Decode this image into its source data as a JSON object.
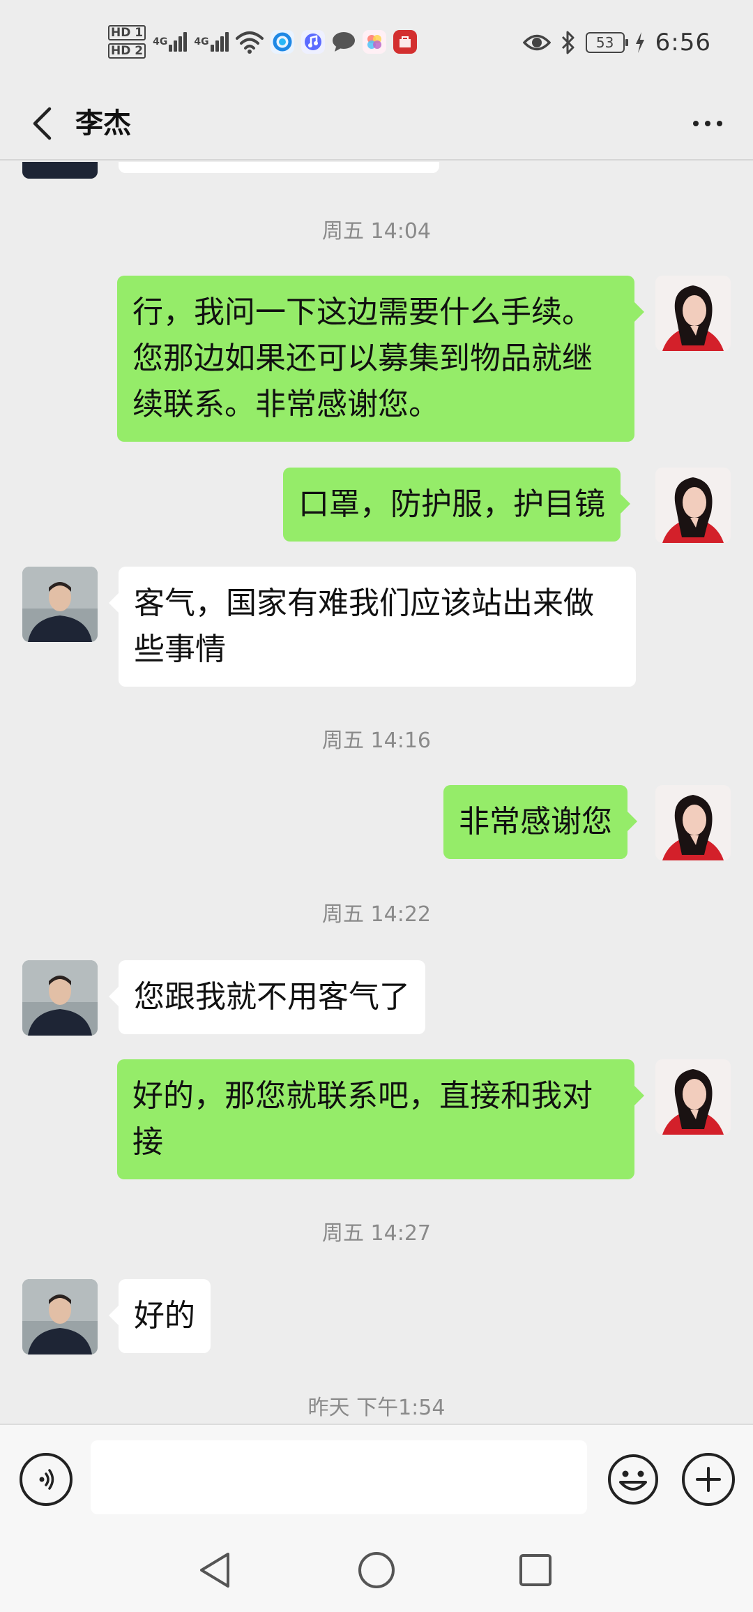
{
  "status_bar": {
    "hd_labels": [
      "HD 1",
      "HD 2"
    ],
    "network_labels": [
      "4G",
      "4G"
    ],
    "battery_level": "53",
    "time": "6:56",
    "icons": [
      "hd-icon",
      "signal-icon",
      "signal-icon",
      "wifi-icon",
      "browser-icon",
      "music-icon",
      "message-icon",
      "photos-icon",
      "huawei-icon",
      "eye-icon",
      "bluetooth-icon",
      "battery-icon",
      "charging-icon"
    ]
  },
  "title_bar": {
    "title": "李杰",
    "back_icon": "chevron-left-icon",
    "more_icon": "more-dots-icon"
  },
  "messages": [
    {
      "type": "partial-left",
      "text": ""
    },
    {
      "type": "time",
      "text": "周五 14:04"
    },
    {
      "type": "right",
      "text": "行，我问一下这边需要什么手续。您那边如果还可以募集到物品就继续联系。非常感谢您。"
    },
    {
      "type": "right",
      "text": "口罩，防护服，护目镜"
    },
    {
      "type": "left",
      "text": "客气，国家有难我们应该站出来做些事情"
    },
    {
      "type": "time",
      "text": "周五 14:16"
    },
    {
      "type": "right",
      "text": "非常感谢您"
    },
    {
      "type": "time",
      "text": "周五 14:22"
    },
    {
      "type": "left",
      "text": "您跟我就不用客气了"
    },
    {
      "type": "right",
      "text": "好的，那您就联系吧，直接和我对接"
    },
    {
      "type": "time",
      "text": "周五 14:27"
    },
    {
      "type": "left",
      "text": "好的"
    },
    {
      "type": "time",
      "text": "昨天 下午1:54"
    }
  ],
  "input_bar": {
    "text_value": "",
    "voice_icon": "voice-icon",
    "emoji_icon": "emoji-icon",
    "plus_icon": "plus-icon"
  },
  "nav_bar": {
    "icons": [
      "nav-back-icon",
      "nav-home-icon",
      "nav-recents-icon"
    ]
  },
  "colors": {
    "background": "#EDEDED",
    "sent_bubble": "#95EC69",
    "received_bubble": "#FFFFFF",
    "timestamp": "#8a8a8a"
  }
}
